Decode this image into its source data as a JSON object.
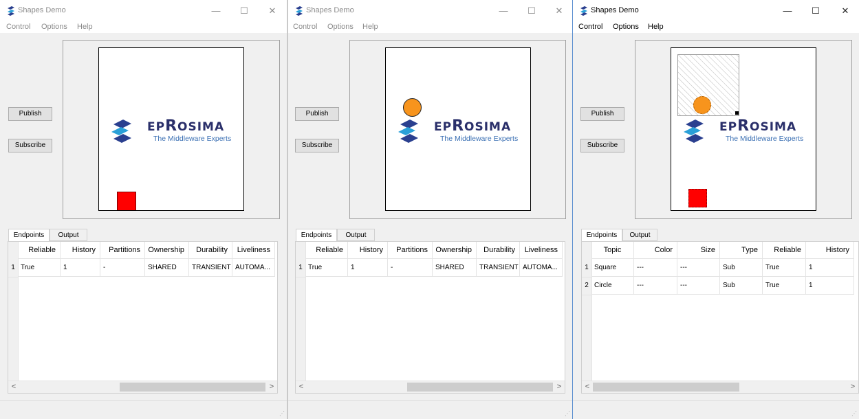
{
  "windows": [
    {
      "title": "Shapes Demo",
      "menu": [
        "Control",
        "Options",
        "Help"
      ],
      "controls": {
        "minimize": "—",
        "maximize": "☐",
        "close": "✕"
      },
      "buttons": {
        "publish": "Publish",
        "subscribe": "Subscribe"
      },
      "logo": {
        "brand": "EPROSIMA",
        "tagline": "The Middleware Experts"
      },
      "tabs": [
        "Endpoints",
        "Output"
      ],
      "columns": [
        "Reliable",
        "History",
        "Partitions",
        "Ownership",
        "Durability",
        "Liveliness"
      ],
      "rows": [
        {
          "num": "1",
          "cells": [
            "True",
            "1",
            "-",
            "SHARED",
            "TRANSIENT",
            "AUTOMA..."
          ]
        }
      ],
      "shapes": [
        {
          "kind": "square",
          "color": "#ff0000"
        }
      ]
    },
    {
      "title": "Shapes Demo",
      "menu": [
        "Control",
        "Options",
        "Help"
      ],
      "controls": {
        "minimize": "—",
        "maximize": "☐",
        "close": "✕"
      },
      "buttons": {
        "publish": "Publish",
        "subscribe": "Subscribe"
      },
      "logo": {
        "brand": "EPROSIMA",
        "tagline": "The Middleware Experts"
      },
      "tabs": [
        "Endpoints",
        "Output"
      ],
      "columns": [
        "Reliable",
        "History",
        "Partitions",
        "Ownership",
        "Durability",
        "Liveliness"
      ],
      "rows": [
        {
          "num": "1",
          "cells": [
            "True",
            "1",
            "-",
            "SHARED",
            "TRANSIENT",
            "AUTOMA..."
          ]
        }
      ],
      "shapes": [
        {
          "kind": "circle",
          "color": "#f7941d"
        }
      ]
    },
    {
      "title": "Shapes Demo",
      "menu": [
        "Control",
        "Options",
        "Help"
      ],
      "controls": {
        "minimize": "—",
        "maximize": "☐",
        "close": "✕"
      },
      "buttons": {
        "publish": "Publish",
        "subscribe": "Subscribe"
      },
      "logo": {
        "brand": "EPROSIMA",
        "tagline": "The Middleware Experts"
      },
      "tabs": [
        "Endpoints",
        "Output"
      ],
      "columns": [
        "Topic",
        "Color",
        "Size",
        "Type",
        "Reliable",
        "History"
      ],
      "rows": [
        {
          "num": "1",
          "cells": [
            "Square",
            "---",
            "---",
            "Sub",
            "True",
            "1"
          ]
        },
        {
          "num": "2",
          "cells": [
            "Circle",
            "---",
            "---",
            "Sub",
            "True",
            "1"
          ]
        }
      ],
      "shapes": [
        {
          "kind": "circle",
          "color": "#f7941d"
        },
        {
          "kind": "square",
          "color": "#ff0000"
        }
      ]
    }
  ],
  "colors": {
    "brand_navy": "#2a2f6a",
    "brand_blue": "#3a6fb3",
    "shape_red": "#ff0000",
    "shape_orange": "#f7941d"
  }
}
